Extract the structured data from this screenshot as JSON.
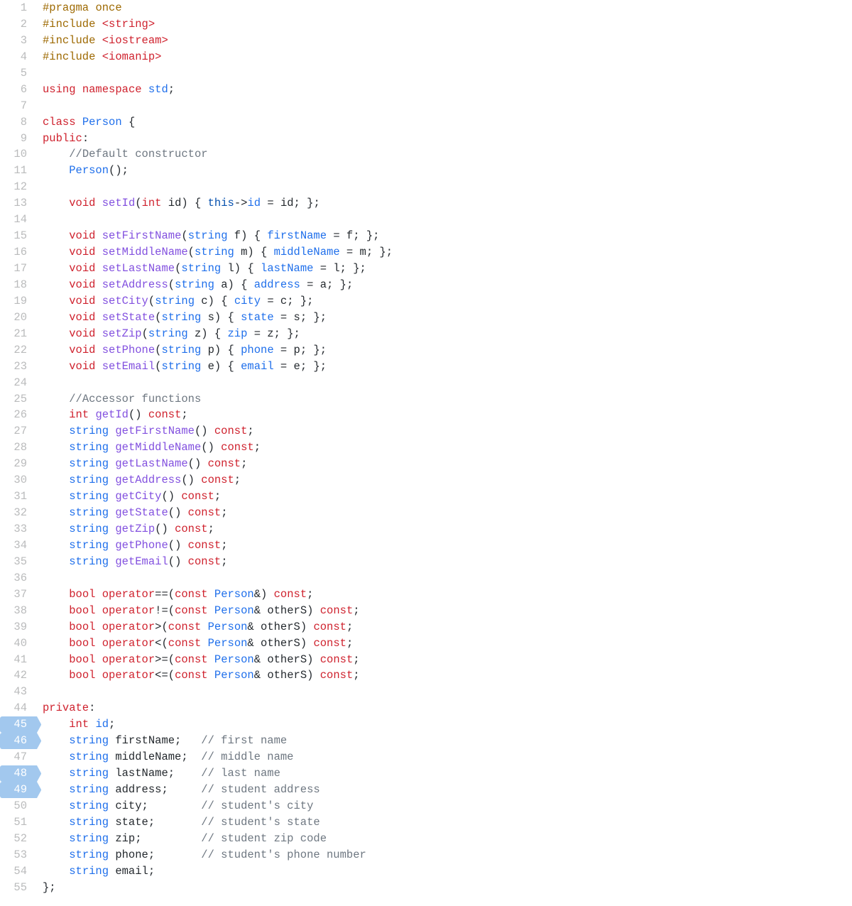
{
  "highlighted_lines": [
    45,
    46,
    48,
    49
  ],
  "lines": [
    {
      "n": 1,
      "t": [
        [
          "dir",
          "#pragma"
        ],
        [
          "id",
          " "
        ],
        [
          "dir",
          "once"
        ]
      ]
    },
    {
      "n": 2,
      "t": [
        [
          "dir",
          "#include"
        ],
        [
          "id",
          " "
        ],
        [
          "inc",
          "<string>"
        ]
      ]
    },
    {
      "n": 3,
      "t": [
        [
          "dir",
          "#include"
        ],
        [
          "id",
          " "
        ],
        [
          "inc",
          "<iostream>"
        ]
      ]
    },
    {
      "n": 4,
      "t": [
        [
          "dir",
          "#include"
        ],
        [
          "id",
          " "
        ],
        [
          "inc",
          "<iomanip>"
        ]
      ]
    },
    {
      "n": 5,
      "t": []
    },
    {
      "n": 6,
      "t": [
        [
          "kw",
          "using"
        ],
        [
          "id",
          " "
        ],
        [
          "kw",
          "namespace"
        ],
        [
          "id",
          " "
        ],
        [
          "typ",
          "std"
        ],
        [
          "id",
          ";"
        ]
      ]
    },
    {
      "n": 7,
      "t": []
    },
    {
      "n": 8,
      "t": [
        [
          "kw",
          "class"
        ],
        [
          "id",
          " "
        ],
        [
          "typ",
          "Person"
        ],
        [
          "id",
          " {"
        ]
      ]
    },
    {
      "n": 9,
      "t": [
        [
          "acc",
          "public"
        ],
        [
          "id",
          ":"
        ]
      ]
    },
    {
      "n": 10,
      "t": [
        [
          "id",
          "    "
        ],
        [
          "cmt",
          "//Default constructor"
        ]
      ]
    },
    {
      "n": 11,
      "t": [
        [
          "id",
          "    "
        ],
        [
          "typ",
          "Person"
        ],
        [
          "id",
          "();"
        ]
      ]
    },
    {
      "n": 12,
      "t": []
    },
    {
      "n": 13,
      "t": [
        [
          "id",
          "    "
        ],
        [
          "kw",
          "void"
        ],
        [
          "id",
          " "
        ],
        [
          "mtd",
          "setId"
        ],
        [
          "id",
          "("
        ],
        [
          "kw",
          "int"
        ],
        [
          "id",
          " id) { "
        ],
        [
          "this",
          "this"
        ],
        [
          "id",
          "->"
        ],
        [
          "fld",
          "id"
        ],
        [
          "id",
          " = id; };"
        ]
      ]
    },
    {
      "n": 14,
      "t": []
    },
    {
      "n": 15,
      "t": [
        [
          "id",
          "    "
        ],
        [
          "kw",
          "void"
        ],
        [
          "id",
          " "
        ],
        [
          "mtd",
          "setFirstName"
        ],
        [
          "id",
          "("
        ],
        [
          "typ",
          "string"
        ],
        [
          "id",
          " f) { "
        ],
        [
          "fld",
          "firstName"
        ],
        [
          "id",
          " = f; };"
        ]
      ]
    },
    {
      "n": 16,
      "t": [
        [
          "id",
          "    "
        ],
        [
          "kw",
          "void"
        ],
        [
          "id",
          " "
        ],
        [
          "mtd",
          "setMiddleName"
        ],
        [
          "id",
          "("
        ],
        [
          "typ",
          "string"
        ],
        [
          "id",
          " m) { "
        ],
        [
          "fld",
          "middleName"
        ],
        [
          "id",
          " = m; };"
        ]
      ]
    },
    {
      "n": 17,
      "t": [
        [
          "id",
          "    "
        ],
        [
          "kw",
          "void"
        ],
        [
          "id",
          " "
        ],
        [
          "mtd",
          "setLastName"
        ],
        [
          "id",
          "("
        ],
        [
          "typ",
          "string"
        ],
        [
          "id",
          " l) { "
        ],
        [
          "fld",
          "lastName"
        ],
        [
          "id",
          " = l; };"
        ]
      ]
    },
    {
      "n": 18,
      "t": [
        [
          "id",
          "    "
        ],
        [
          "kw",
          "void"
        ],
        [
          "id",
          " "
        ],
        [
          "mtd",
          "setAddress"
        ],
        [
          "id",
          "("
        ],
        [
          "typ",
          "string"
        ],
        [
          "id",
          " a) { "
        ],
        [
          "fld",
          "address"
        ],
        [
          "id",
          " = a; };"
        ]
      ]
    },
    {
      "n": 19,
      "t": [
        [
          "id",
          "    "
        ],
        [
          "kw",
          "void"
        ],
        [
          "id",
          " "
        ],
        [
          "mtd",
          "setCity"
        ],
        [
          "id",
          "("
        ],
        [
          "typ",
          "string"
        ],
        [
          "id",
          " c) { "
        ],
        [
          "fld",
          "city"
        ],
        [
          "id",
          " = c; };"
        ]
      ]
    },
    {
      "n": 20,
      "t": [
        [
          "id",
          "    "
        ],
        [
          "kw",
          "void"
        ],
        [
          "id",
          " "
        ],
        [
          "mtd",
          "setState"
        ],
        [
          "id",
          "("
        ],
        [
          "typ",
          "string"
        ],
        [
          "id",
          " s) { "
        ],
        [
          "fld",
          "state"
        ],
        [
          "id",
          " = s; };"
        ]
      ]
    },
    {
      "n": 21,
      "t": [
        [
          "id",
          "    "
        ],
        [
          "kw",
          "void"
        ],
        [
          "id",
          " "
        ],
        [
          "mtd",
          "setZip"
        ],
        [
          "id",
          "("
        ],
        [
          "typ",
          "string"
        ],
        [
          "id",
          " z) { "
        ],
        [
          "fld",
          "zip"
        ],
        [
          "id",
          " = z; };"
        ]
      ]
    },
    {
      "n": 22,
      "t": [
        [
          "id",
          "    "
        ],
        [
          "kw",
          "void"
        ],
        [
          "id",
          " "
        ],
        [
          "mtd",
          "setPhone"
        ],
        [
          "id",
          "("
        ],
        [
          "typ",
          "string"
        ],
        [
          "id",
          " p) { "
        ],
        [
          "fld",
          "phone"
        ],
        [
          "id",
          " = p; };"
        ]
      ]
    },
    {
      "n": 23,
      "t": [
        [
          "id",
          "    "
        ],
        [
          "kw",
          "void"
        ],
        [
          "id",
          " "
        ],
        [
          "mtd",
          "setEmail"
        ],
        [
          "id",
          "("
        ],
        [
          "typ",
          "string"
        ],
        [
          "id",
          " e) { "
        ],
        [
          "fld",
          "email"
        ],
        [
          "id",
          " = e; };"
        ]
      ]
    },
    {
      "n": 24,
      "t": []
    },
    {
      "n": 25,
      "t": [
        [
          "id",
          "    "
        ],
        [
          "cmt",
          "//Accessor functions"
        ]
      ]
    },
    {
      "n": 26,
      "t": [
        [
          "id",
          "    "
        ],
        [
          "kw",
          "int"
        ],
        [
          "id",
          " "
        ],
        [
          "mtd",
          "getId"
        ],
        [
          "id",
          "() "
        ],
        [
          "kw",
          "const"
        ],
        [
          "id",
          ";"
        ]
      ]
    },
    {
      "n": 27,
      "t": [
        [
          "id",
          "    "
        ],
        [
          "typ",
          "string"
        ],
        [
          "id",
          " "
        ],
        [
          "mtd",
          "getFirstName"
        ],
        [
          "id",
          "() "
        ],
        [
          "kw",
          "const"
        ],
        [
          "id",
          ";"
        ]
      ]
    },
    {
      "n": 28,
      "t": [
        [
          "id",
          "    "
        ],
        [
          "typ",
          "string"
        ],
        [
          "id",
          " "
        ],
        [
          "mtd",
          "getMiddleName"
        ],
        [
          "id",
          "() "
        ],
        [
          "kw",
          "const"
        ],
        [
          "id",
          ";"
        ]
      ]
    },
    {
      "n": 29,
      "t": [
        [
          "id",
          "    "
        ],
        [
          "typ",
          "string"
        ],
        [
          "id",
          " "
        ],
        [
          "mtd",
          "getLastName"
        ],
        [
          "id",
          "() "
        ],
        [
          "kw",
          "const"
        ],
        [
          "id",
          ";"
        ]
      ]
    },
    {
      "n": 30,
      "t": [
        [
          "id",
          "    "
        ],
        [
          "typ",
          "string"
        ],
        [
          "id",
          " "
        ],
        [
          "mtd",
          "getAddress"
        ],
        [
          "id",
          "() "
        ],
        [
          "kw",
          "const"
        ],
        [
          "id",
          ";"
        ]
      ]
    },
    {
      "n": 31,
      "t": [
        [
          "id",
          "    "
        ],
        [
          "typ",
          "string"
        ],
        [
          "id",
          " "
        ],
        [
          "mtd",
          "getCity"
        ],
        [
          "id",
          "() "
        ],
        [
          "kw",
          "const"
        ],
        [
          "id",
          ";"
        ]
      ]
    },
    {
      "n": 32,
      "t": [
        [
          "id",
          "    "
        ],
        [
          "typ",
          "string"
        ],
        [
          "id",
          " "
        ],
        [
          "mtd",
          "getState"
        ],
        [
          "id",
          "() "
        ],
        [
          "kw",
          "const"
        ],
        [
          "id",
          ";"
        ]
      ]
    },
    {
      "n": 33,
      "t": [
        [
          "id",
          "    "
        ],
        [
          "typ",
          "string"
        ],
        [
          "id",
          " "
        ],
        [
          "mtd",
          "getZip"
        ],
        [
          "id",
          "() "
        ],
        [
          "kw",
          "const"
        ],
        [
          "id",
          ";"
        ]
      ]
    },
    {
      "n": 34,
      "t": [
        [
          "id",
          "    "
        ],
        [
          "typ",
          "string"
        ],
        [
          "id",
          " "
        ],
        [
          "mtd",
          "getPhone"
        ],
        [
          "id",
          "() "
        ],
        [
          "kw",
          "const"
        ],
        [
          "id",
          ";"
        ]
      ]
    },
    {
      "n": 35,
      "t": [
        [
          "id",
          "    "
        ],
        [
          "typ",
          "string"
        ],
        [
          "id",
          " "
        ],
        [
          "mtd",
          "getEmail"
        ],
        [
          "id",
          "() "
        ],
        [
          "kw",
          "const"
        ],
        [
          "id",
          ";"
        ]
      ]
    },
    {
      "n": 36,
      "t": []
    },
    {
      "n": 37,
      "t": [
        [
          "id",
          "    "
        ],
        [
          "kw",
          "bool"
        ],
        [
          "id",
          " "
        ],
        [
          "kw",
          "operator"
        ],
        [
          "id",
          "==("
        ],
        [
          "kw",
          "const"
        ],
        [
          "id",
          " "
        ],
        [
          "typ",
          "Person"
        ],
        [
          "id",
          "&) "
        ],
        [
          "kw",
          "const"
        ],
        [
          "id",
          ";"
        ]
      ]
    },
    {
      "n": 38,
      "t": [
        [
          "id",
          "    "
        ],
        [
          "kw",
          "bool"
        ],
        [
          "id",
          " "
        ],
        [
          "kw",
          "operator"
        ],
        [
          "id",
          "!=("
        ],
        [
          "kw",
          "const"
        ],
        [
          "id",
          " "
        ],
        [
          "typ",
          "Person"
        ],
        [
          "id",
          "& otherS) "
        ],
        [
          "kw",
          "const"
        ],
        [
          "id",
          ";"
        ]
      ]
    },
    {
      "n": 39,
      "t": [
        [
          "id",
          "    "
        ],
        [
          "kw",
          "bool"
        ],
        [
          "id",
          " "
        ],
        [
          "kw",
          "operator"
        ],
        [
          "id",
          ">("
        ],
        [
          "kw",
          "const"
        ],
        [
          "id",
          " "
        ],
        [
          "typ",
          "Person"
        ],
        [
          "id",
          "& otherS) "
        ],
        [
          "kw",
          "const"
        ],
        [
          "id",
          ";"
        ]
      ]
    },
    {
      "n": 40,
      "t": [
        [
          "id",
          "    "
        ],
        [
          "kw",
          "bool"
        ],
        [
          "id",
          " "
        ],
        [
          "kw",
          "operator"
        ],
        [
          "id",
          "<("
        ],
        [
          "kw",
          "const"
        ],
        [
          "id",
          " "
        ],
        [
          "typ",
          "Person"
        ],
        [
          "id",
          "& otherS) "
        ],
        [
          "kw",
          "const"
        ],
        [
          "id",
          ";"
        ]
      ]
    },
    {
      "n": 41,
      "t": [
        [
          "id",
          "    "
        ],
        [
          "kw",
          "bool"
        ],
        [
          "id",
          " "
        ],
        [
          "kw",
          "operator"
        ],
        [
          "id",
          ">=("
        ],
        [
          "kw",
          "const"
        ],
        [
          "id",
          " "
        ],
        [
          "typ",
          "Person"
        ],
        [
          "id",
          "& otherS) "
        ],
        [
          "kw",
          "const"
        ],
        [
          "id",
          ";"
        ]
      ]
    },
    {
      "n": 42,
      "t": [
        [
          "id",
          "    "
        ],
        [
          "kw",
          "bool"
        ],
        [
          "id",
          " "
        ],
        [
          "kw",
          "operator"
        ],
        [
          "id",
          "<=("
        ],
        [
          "kw",
          "const"
        ],
        [
          "id",
          " "
        ],
        [
          "typ",
          "Person"
        ],
        [
          "id",
          "& otherS) "
        ],
        [
          "kw",
          "const"
        ],
        [
          "id",
          ";"
        ]
      ]
    },
    {
      "n": 43,
      "t": []
    },
    {
      "n": 44,
      "t": [
        [
          "acc",
          "private"
        ],
        [
          "id",
          ":"
        ]
      ]
    },
    {
      "n": 45,
      "t": [
        [
          "id",
          "    "
        ],
        [
          "kw",
          "int"
        ],
        [
          "id",
          " "
        ],
        [
          "fld",
          "id"
        ],
        [
          "id",
          ";"
        ]
      ]
    },
    {
      "n": 46,
      "t": [
        [
          "id",
          "    "
        ],
        [
          "typ",
          "string"
        ],
        [
          "id",
          " firstName;   "
        ],
        [
          "cmt",
          "// first name"
        ]
      ]
    },
    {
      "n": 47,
      "t": [
        [
          "id",
          "    "
        ],
        [
          "typ",
          "string"
        ],
        [
          "id",
          " middleName;  "
        ],
        [
          "cmt",
          "// middle name"
        ]
      ]
    },
    {
      "n": 48,
      "t": [
        [
          "id",
          "    "
        ],
        [
          "typ",
          "string"
        ],
        [
          "id",
          " lastName;    "
        ],
        [
          "cmt",
          "// last name"
        ]
      ]
    },
    {
      "n": 49,
      "t": [
        [
          "id",
          "    "
        ],
        [
          "typ",
          "string"
        ],
        [
          "id",
          " address;     "
        ],
        [
          "cmt",
          "// student address"
        ]
      ]
    },
    {
      "n": 50,
      "t": [
        [
          "id",
          "    "
        ],
        [
          "typ",
          "string"
        ],
        [
          "id",
          " city;        "
        ],
        [
          "cmt",
          "// student's city"
        ]
      ]
    },
    {
      "n": 51,
      "t": [
        [
          "id",
          "    "
        ],
        [
          "typ",
          "string"
        ],
        [
          "id",
          " state;       "
        ],
        [
          "cmt",
          "// student's state"
        ]
      ]
    },
    {
      "n": 52,
      "t": [
        [
          "id",
          "    "
        ],
        [
          "typ",
          "string"
        ],
        [
          "id",
          " zip;         "
        ],
        [
          "cmt",
          "// student zip code"
        ]
      ]
    },
    {
      "n": 53,
      "t": [
        [
          "id",
          "    "
        ],
        [
          "typ",
          "string"
        ],
        [
          "id",
          " phone;       "
        ],
        [
          "cmt",
          "// student's phone number"
        ]
      ]
    },
    {
      "n": 54,
      "t": [
        [
          "id",
          "    "
        ],
        [
          "typ",
          "string"
        ],
        [
          "id",
          " email;"
        ]
      ]
    },
    {
      "n": 55,
      "t": [
        [
          "id",
          "};"
        ]
      ]
    }
  ]
}
